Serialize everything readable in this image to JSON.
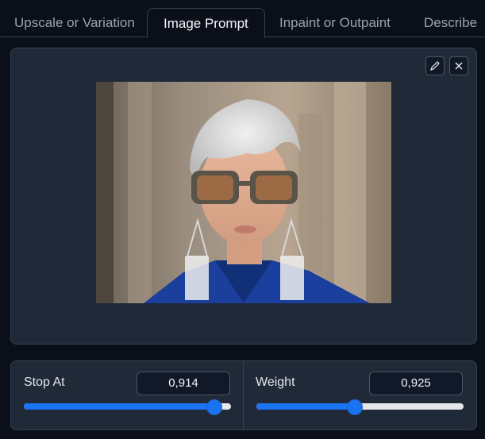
{
  "tabs": [
    {
      "label": "Upscale or Variation",
      "active": false
    },
    {
      "label": "Image Prompt",
      "active": true
    },
    {
      "label": "Inpaint or Outpaint",
      "active": false
    },
    {
      "label": "Describe",
      "active": false
    }
  ],
  "image_panel": {
    "edit_icon": "pencil-icon",
    "close_icon": "close-icon"
  },
  "sliders": {
    "stop_at": {
      "label": "Stop At",
      "value": "0,914",
      "fraction": 0.914
    },
    "weight": {
      "label": "Weight",
      "value": "0,925",
      "fraction": 0.47
    }
  },
  "colors": {
    "background": "#0b0f19",
    "panel": "#1f2937",
    "accent": "#1a73f0",
    "border": "#374151"
  }
}
